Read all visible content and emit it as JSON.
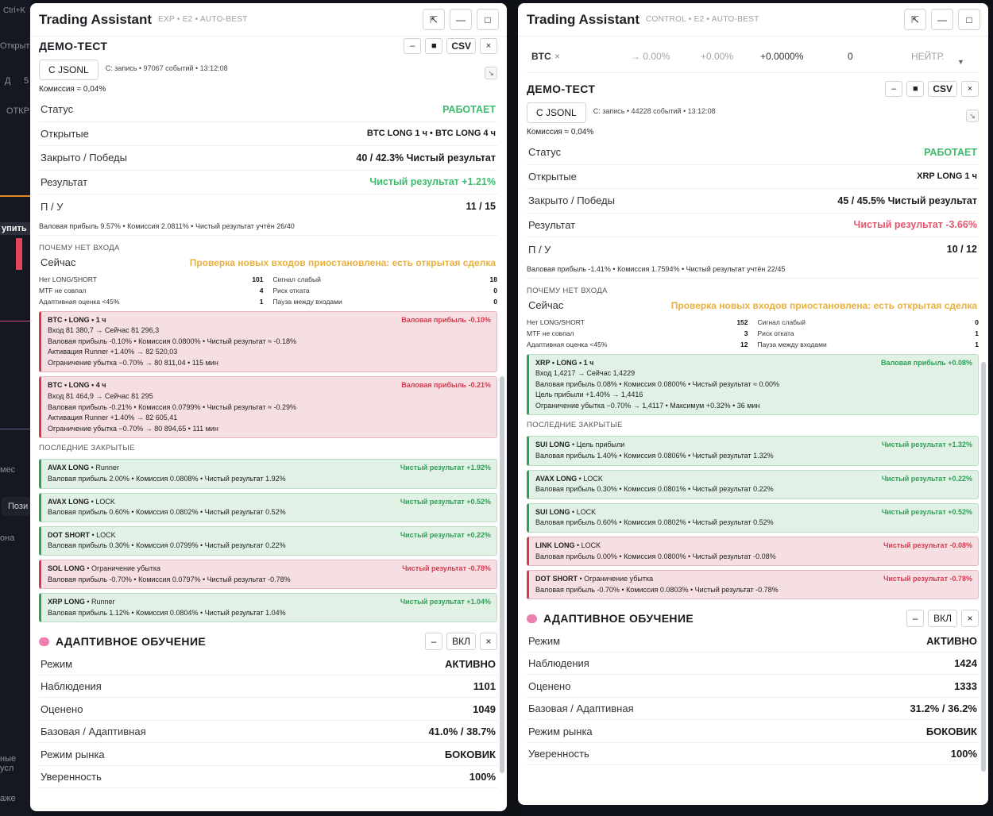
{
  "background": {
    "top_left_text": "Ctrl+K",
    "left_labels": [
      "Открыт",
      "Д",
      "5",
      "ОТКР",
      "упить",
      "мес",
      "Пози",
      "она",
      "ные усл",
      "аже"
    ]
  },
  "panels": [
    {
      "title": "Trading Assistant",
      "subtitle": "EXP • E2 • AUTO-BEST",
      "header_buttons": [
        "⇱",
        "—",
        "□"
      ],
      "demo": {
        "title": "ДЕМО-ТЕСТ",
        "buttons": [
          "–",
          "■",
          "CSV",
          "×"
        ],
        "jsonl_label": "С JSONL",
        "record": "С: запись • 97067 событий • 13:12:08",
        "fee": "Комиссия ≈ 0,04%",
        "status_label": "Статус",
        "status_value": "РАБОТАЕТ",
        "open_label": "Открытые",
        "open_value": "BTC LONG 1 ч • BTC LONG 4 ч",
        "closed_label": "Закрыто / Победы",
        "closed_value": "40 / 42.3% Чистый результат",
        "result_label": "Результат",
        "result_value": "Чистый результат +1.21%",
        "pu_label": "П / У",
        "pu_value": "11 / 15",
        "note": "Валовая прибыль 9.57% • Комиссия 2.0811% • Чистый результат учтён 26/40",
        "why_title": "ПОЧЕМУ НЕТ ВХОДА",
        "now_label": "Сейчас",
        "now_value": "Проверка новых входов приостановлена: есть открытая сделка",
        "reasons_left": [
          {
            "label": "Нет LONG/SHORT",
            "value": "101"
          },
          {
            "label": "MTF не совпал",
            "value": "4"
          },
          {
            "label": "Адаптивная оценка <45%",
            "value": "1"
          }
        ],
        "reasons_right": [
          {
            "label": "Сигнал слабый",
            "value": "18"
          },
          {
            "label": "Риск отката",
            "value": "0"
          },
          {
            "label": "Пауза между входами",
            "value": "0"
          }
        ],
        "open_cards": [
          {
            "title": "BTC • LONG • 1 ч",
            "tag": "Валовая прибыль -0.10%",
            "lines": [
              "Вход 81 380,7 → Сейчас 81 296,3",
              "Валовая прибыль -0.10% • Комиссия 0.0800% • Чистый результат ≈ -0.18%",
              "Активация Runner +1.40% → 82 520,03",
              "Ограничение убытка −0.70% → 80 811,04 • 115 мин"
            ]
          },
          {
            "title": "BTC • LONG • 4 ч",
            "tag": "Валовая прибыль -0.21%",
            "lines": [
              "Вход 81 464,9 → Сейчас 81 295",
              "Валовая прибыль -0.21% • Комиссия 0.0799% • Чистый результат ≈ -0.29%",
              "Активация Runner +1.40% → 82 605,41",
              "Ограничение убытка −0.70% → 80 894,65 • 111 мин"
            ]
          }
        ],
        "closed_title": "ПОСЛЕДНИЕ ЗАКРЫТЫЕ",
        "closed_cards": [
          {
            "sym": "AVAX LONG",
            "reason": " • Runner",
            "tag": "Чистый результат +1.92%",
            "win": true,
            "line": "Валовая прибыль 2.00% • Комиссия 0.0808% • Чистый результат 1.92%"
          },
          {
            "sym": "AVAX LONG",
            "reason": " • LOCK",
            "tag": "Чистый результат +0.52%",
            "win": true,
            "line": "Валовая прибыль 0.60% • Комиссия 0.0802% • Чистый результат 0.52%"
          },
          {
            "sym": "DOT SHORT",
            "reason": " • LOCK",
            "tag": "Чистый результат +0.22%",
            "win": true,
            "line": "Валовая прибыль 0.30% • Комиссия 0.0799% • Чистый результат 0.22%"
          },
          {
            "sym": "SOL LONG",
            "reason": " • Ограничение убытка",
            "tag": "Чистый результат -0.78%",
            "win": false,
            "line": "Валовая прибыль -0.70% • Комиссия 0.0797% • Чистый результат -0.78%"
          },
          {
            "sym": "XRP LONG",
            "reason": " • Runner",
            "tag": "Чистый результат +1.04%",
            "win": true,
            "line": "Валовая прибыль 1.12% • Комиссия 0.0804% • Чистый результат 1.04%"
          }
        ]
      },
      "adaptive": {
        "title": "АДАПТИВНОЕ ОБУЧЕНИЕ",
        "buttons": [
          "–",
          "ВКЛ",
          "×"
        ],
        "rows": [
          {
            "label": "Режим",
            "value": "АКТИВНО"
          },
          {
            "label": "Наблюдения",
            "value": "1101"
          },
          {
            "label": "Оценено",
            "value": "1049"
          },
          {
            "label": "Базовая / Адаптивная",
            "value": "41.0% / 38.7%"
          },
          {
            "label": "Режим рынка",
            "value": "БОКОВИК"
          },
          {
            "label": "Уверенность",
            "value": "100%"
          }
        ]
      }
    },
    {
      "title": "Trading Assistant",
      "subtitle": "CONTROL • E2 • AUTO-BEST",
      "header_buttons": [
        "⇱",
        "—",
        "□"
      ],
      "ticker": {
        "sym": "BTC",
        "remove": "×",
        "a": "→ 0.00%",
        "b": "+0.00%",
        "c": "+0.0000%",
        "d": "0",
        "e": "НЕЙТР."
      },
      "demo": {
        "title": "ДЕМО-ТЕСТ",
        "buttons": [
          "–",
          "■",
          "CSV",
          "×"
        ],
        "jsonl_label": "С JSONL",
        "record": "С: запись • 44228 событий • 13:12:08",
        "fee": "Комиссия ≈ 0,04%",
        "status_label": "Статус",
        "status_value": "РАБОТАЕТ",
        "open_label": "Открытые",
        "open_value": "XRP LONG 1 ч",
        "closed_label": "Закрыто / Победы",
        "closed_value": "45 / 45.5% Чистый результат",
        "result_label": "Результат",
        "result_value": "Чистый результат -3.66%",
        "pu_label": "П / У",
        "pu_value": "10 / 12",
        "note": "Валовая прибыль -1.41% • Комиссия 1.7594% • Чистый результат учтён 22/45",
        "why_title": "ПОЧЕМУ НЕТ ВХОДА",
        "now_label": "Сейчас",
        "now_value": "Проверка новых входов приостановлена: есть открытая сделка",
        "reasons_left": [
          {
            "label": "Нет LONG/SHORT",
            "value": "152"
          },
          {
            "label": "MTF не совпал",
            "value": "3"
          },
          {
            "label": "Адаптивная оценка <45%",
            "value": "12"
          }
        ],
        "reasons_right": [
          {
            "label": "Сигнал слабый",
            "value": "0"
          },
          {
            "label": "Риск отката",
            "value": "1"
          },
          {
            "label": "Пауза между входами",
            "value": "1"
          }
        ],
        "open_cards": [
          {
            "title": "XRP • LONG • 1 ч",
            "tag": "Валовая прибыль +0.08%",
            "lines": [
              "Вход 1,4217 → Сейчас 1,4229",
              "Валовая прибыль 0.08% • Комиссия 0.0800% • Чистый результат ≈ 0.00%",
              "Цель прибыли +1.40% → 1,4416",
              "Ограничение убытка −0.70% → 1,4117 • Максимум +0.32% • 36 мин"
            ]
          }
        ],
        "closed_title": "ПОСЛЕДНИЕ ЗАКРЫТЫЕ",
        "closed_cards": [
          {
            "sym": "SUI LONG",
            "reason": " • Цель прибыли",
            "tag": "Чистый результат +1.32%",
            "win": true,
            "line": "Валовая прибыль 1.40% • Комиссия 0.0806% • Чистый результат 1.32%"
          },
          {
            "sym": "AVAX LONG",
            "reason": " • LOCK",
            "tag": "Чистый результат +0.22%",
            "win": true,
            "line": "Валовая прибыль 0.30% • Комиссия 0.0801% • Чистый результат 0.22%"
          },
          {
            "sym": "SUI LONG",
            "reason": " • LOCK",
            "tag": "Чистый результат +0.52%",
            "win": true,
            "line": "Валовая прибыль 0.60% • Комиссия 0.0802% • Чистый результат 0.52%"
          },
          {
            "sym": "LINK LONG",
            "reason": " • LOCK",
            "tag": "Чистый результат -0.08%",
            "win": false,
            "line": "Валовая прибыль 0.00% • Комиссия 0.0800% • Чистый результат -0.08%"
          },
          {
            "sym": "DOT SHORT",
            "reason": " • Ограничение убытка",
            "tag": "Чистый результат -0.78%",
            "win": false,
            "line": "Валовая прибыль -0.70% • Комиссия 0.0803% • Чистый результат -0.78%"
          }
        ]
      },
      "adaptive": {
        "title": "АДАПТИВНОЕ ОБУЧЕНИЕ",
        "buttons": [
          "–",
          "ВКЛ",
          "×"
        ],
        "rows": [
          {
            "label": "Режим",
            "value": "АКТИВНО"
          },
          {
            "label": "Наблюдения",
            "value": "1424"
          },
          {
            "label": "Оценено",
            "value": "1333"
          },
          {
            "label": "Базовая / Адаптивная",
            "value": "31.2% / 36.2%"
          },
          {
            "label": "Режим рынка",
            "value": "БОКОВИК"
          },
          {
            "label": "Уверенность",
            "value": "100%"
          }
        ]
      }
    }
  ],
  "colors": {
    "positive": "#3dbb6d",
    "negative": "#e5566b",
    "warning": "#eab03d",
    "card_win_bg": "#e2f1e6",
    "card_loss_bg": "#f6dfe2"
  }
}
